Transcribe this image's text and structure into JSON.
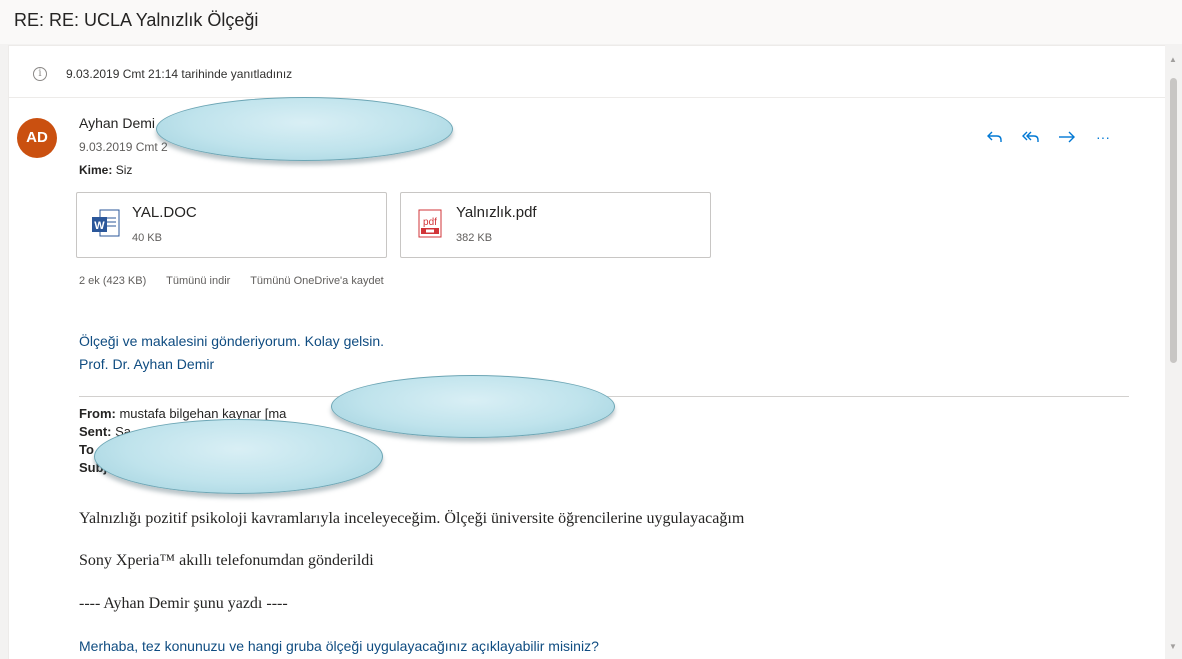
{
  "subject": "RE: RE: UCLA Yalnızlık Ölçeği",
  "info": {
    "icon": "info-icon",
    "text": "9.03.2019 Cmt 21:14 tarihinde yanıtladınız"
  },
  "message": {
    "avatar_initials": "AD",
    "avatar_color": "#ca5010",
    "sender": "Ayhan Demi",
    "date": "9.03.2019 Cmt 2",
    "to_label": "Kime:",
    "to_value": "Siz"
  },
  "actions": {
    "reply": "reply-icon",
    "reply_all": "reply-all-icon",
    "forward": "forward-icon",
    "more": "···"
  },
  "attachments": [
    {
      "name": "YAL.DOC",
      "size": "40 KB",
      "icon": "word-icon"
    },
    {
      "name": "Yalnızlık.pdf",
      "size": "382 KB",
      "icon": "pdf-icon"
    }
  ],
  "attachment_meta": {
    "count": "2 ek (423 KB)",
    "download_all": "Tümünü indir",
    "save_onedrive": "Tümünü OneDrive'a kaydet"
  },
  "body": {
    "line1": "Ölçeği ve makalesini gönderiyorum. Kolay gelsin.",
    "line2": "Prof. Dr. Ayhan Demir"
  },
  "quoted": {
    "from_label": "From:",
    "from_value": "mustafa bilgehan kaynar [ma",
    "sent_label": "Sent:",
    "sent_value": "Sa",
    "to_label": "To",
    "subject_label": "Subje",
    "para1": "Yalnızlığı pozitif psikoloji kavramlarıyla inceleyeceğim. Ölçeği üniversite öğrencilerine uygulayacağım",
    "para2": "Sony Xperia™ akıllı telefonumdan gönderildi",
    "para3": "---- Ayhan Demir şunu yazdı ----",
    "para4": "Merhaba, tez konunuzu ve hangi gruba ölçeği uygulayacağınız açıklayabilir misiniz?"
  },
  "colors": {
    "accent": "#0078d4",
    "link": "#0f4c81",
    "redaction": "#bfe3ec"
  }
}
